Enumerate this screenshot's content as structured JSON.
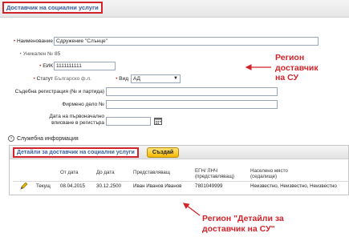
{
  "header": {
    "title": "Доставчик на социални услуги"
  },
  "form": {
    "name_label": "Наименование",
    "name_value": "Сдружение \"Слънце\"",
    "unique_no_label": "Уникален №",
    "unique_no_value": "85",
    "eik_label": "ЕИК",
    "eik_value": "1111111111",
    "status_label": "Статут",
    "status_value": "Българско ф.л.",
    "type_label": "Вид",
    "type_value": "АД",
    "court_reg_label": "Съдебна регистрация (№ и партида)",
    "company_case_label": "Фирмено дело №",
    "first_reg_date_label_1": "Дата на първоначално",
    "first_reg_date_label_2": "вписване в регистъра"
  },
  "service_info": {
    "label": "Служебна информация"
  },
  "details_panel": {
    "title": "Детайли за доставчик на социални услуги",
    "create_button": "Създай",
    "columns": [
      "От дата",
      "До дата",
      "Представляващ",
      "ЕГН/ ЛНЧ (представляващ)",
      "Населено място (седалище)"
    ],
    "rows": [
      {
        "status": "Текущ",
        "from_date": "08.04.2015",
        "to_date": "30.12.2500",
        "representative": "Иван Иванов Иванов",
        "egn": "7801049999",
        "settlement": "Неизвестно, Неизвестно, Неизвестно"
      }
    ]
  },
  "annotations": {
    "region_provider": [
      "Регион",
      "доставчик",
      "на СУ"
    ],
    "region_details": [
      "Регион \"Детайли за",
      "доставчик на СУ\""
    ]
  },
  "colors": {
    "annotation_red": "#d2232a",
    "title_blue": "#3b5fa0",
    "button_yellow": "#f5b800"
  },
  "icons": {
    "calendar": "calendar-icon",
    "edit": "pencil-icon",
    "expand": "chevron-right-icon"
  }
}
